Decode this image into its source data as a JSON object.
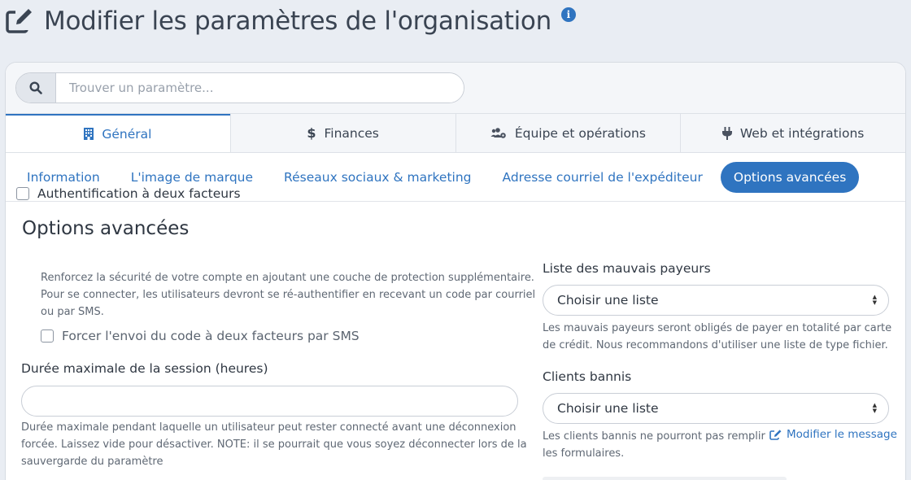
{
  "header": {
    "title": "Modifier les paramètres de l'organisation",
    "title_icon": "edit-icon",
    "info_icon": "info-icon",
    "info_glyph": "i"
  },
  "search": {
    "placeholder": "Trouver un paramètre...",
    "value": "",
    "icon": "search-icon"
  },
  "main_tabs": [
    {
      "label": "Général",
      "icon": "building-icon",
      "active": true
    },
    {
      "label": "Finances",
      "icon": "dollar-icon",
      "active": false
    },
    {
      "label": "Équipe et opérations",
      "icon": "users-cog-icon",
      "active": false
    },
    {
      "label": "Web et intégrations",
      "icon": "plug-icon",
      "active": false
    }
  ],
  "sub_tabs": [
    {
      "label": "Information",
      "active": false
    },
    {
      "label": "L'image de marque",
      "active": false
    },
    {
      "label": "Réseaux sociaux & marketing",
      "active": false
    },
    {
      "label": "Adresse courriel de l'expéditeur",
      "active": false
    },
    {
      "label": "Options avancées",
      "active": true
    }
  ],
  "section": {
    "title": "Options avancées",
    "two_factor": {
      "label": "Authentification à deux facteurs",
      "checked": false,
      "help_lines": [
        "Renforcez la sécurité de votre compte en ajoutant une couche de protection supplémentaire.",
        "Pour se connecter, les utilisateurs devront se ré-authentifier en recevant un code par courriel",
        "ou par SMS."
      ]
    },
    "force_sms": {
      "label": "Forcer l'envoi du code à deux facteurs par SMS",
      "checked": false
    },
    "session": {
      "label": "Durée maximale de la session (heures)",
      "value": "",
      "help_lines": [
        "Durée maximale pendant laquelle un utilisateur peut rester connecté avant une déconnexion",
        "forcée. Laissez vide pour désactiver. NOTE: il se pourrait que vous soyez déconnecter lors de la",
        "sauvergarde du paramètre"
      ]
    },
    "bad_payers": {
      "label": "Liste des mauvais payeurs",
      "selected": "Choisir une liste",
      "help_lines": [
        "Les mauvais payeurs seront obligés de payer en totalité par carte",
        "de crédit. Nous recommandons d'utiliser une liste de type fichier."
      ]
    },
    "banned_clients": {
      "label": "Clients bannis",
      "selected": "Choisir une liste",
      "help_lines": [
        "Les clients bannis ne pourront pas remplir",
        "les formulaires."
      ],
      "edit_link": "Modifier le message"
    }
  },
  "colors": {
    "accent": "#2f74c0",
    "background": "#e9edf3",
    "card": "#ffffff"
  }
}
